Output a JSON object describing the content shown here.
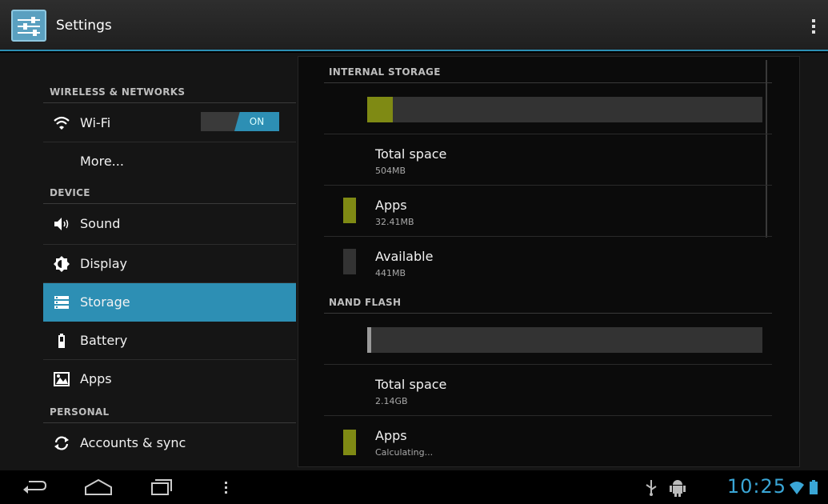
{
  "action_bar": {
    "title": "Settings"
  },
  "sidebar": {
    "sections": [
      {
        "label": "WIRELESS & NETWORKS"
      },
      {
        "label": "DEVICE"
      },
      {
        "label": "PERSONAL"
      }
    ],
    "items": [
      {
        "label": "Wi-Fi",
        "icon": "wifi-icon",
        "toggle": "ON"
      },
      {
        "label": "More..."
      },
      {
        "label": "Sound",
        "icon": "speaker-icon"
      },
      {
        "label": "Display",
        "icon": "brightness-icon"
      },
      {
        "label": "Storage",
        "icon": "storage-icon",
        "selected": true
      },
      {
        "label": "Battery",
        "icon": "battery-icon"
      },
      {
        "label": "Apps",
        "icon": "apps-icon"
      },
      {
        "label": "Accounts & sync",
        "icon": "sync-icon"
      }
    ]
  },
  "storage": {
    "internal": {
      "header": "INTERNAL STORAGE",
      "used_fraction": 0.064,
      "total_label": "Total space",
      "total_value": "504MB",
      "apps_label": "Apps",
      "apps_value": "32.41MB",
      "available_label": "Available",
      "available_value": "441MB"
    },
    "nand": {
      "header": "NAND FLASH",
      "used_fraction": 0.01,
      "total_label": "Total space",
      "total_value": "2.14GB",
      "apps_label": "Apps",
      "apps_value": "Calculating..."
    }
  },
  "status_bar": {
    "time": "10:25"
  },
  "colors": {
    "accent": "#2d8fb4",
    "apps_color": "#7f8a14",
    "clock": "#3aa6d6"
  }
}
